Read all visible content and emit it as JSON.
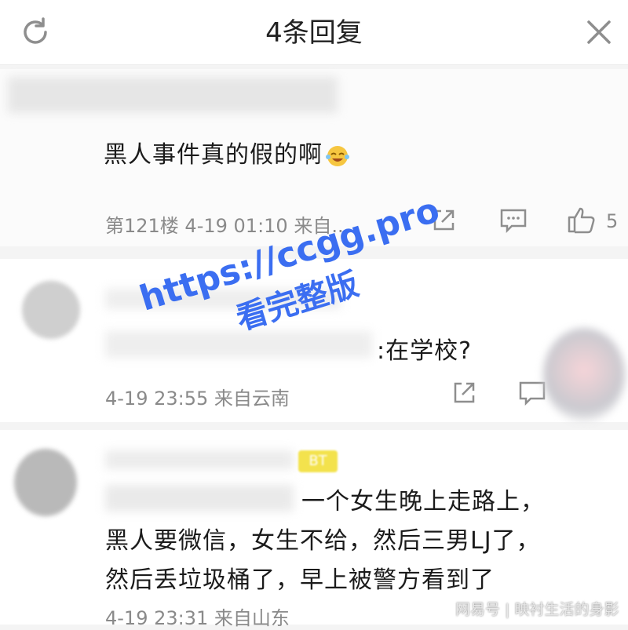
{
  "header": {
    "title": "4条回复"
  },
  "comments": [
    {
      "text": "黑人事件真的假的啊",
      "meta": "第121楼 4-19 01:10 来自...",
      "likes": "5"
    },
    {
      "text": ":在学校?",
      "meta": "4-19 23:55 来自云南"
    },
    {
      "badge": "BT",
      "line1": "一个女生晚上走路上，",
      "line2": "黑人要微信，女生不给，然后三男LJ了，",
      "line3": "然后丢垃圾桶了，早上被警方看到了",
      "meta": "4-19 23:31 来自山东"
    }
  ],
  "watermark": {
    "line1": "https://ccgg.pro",
    "line2": "看完整版"
  },
  "footer_watermark": "网易号 | 映衬生活的身影",
  "icons": [
    "refresh-icon",
    "close-icon",
    "share-icon",
    "comment-icon",
    "like-icon",
    "laughing-emoji-icon"
  ],
  "colors": {
    "watermark": "#3b6ef1",
    "badge": "#f3e24d",
    "meta": "#8a8a8a"
  }
}
